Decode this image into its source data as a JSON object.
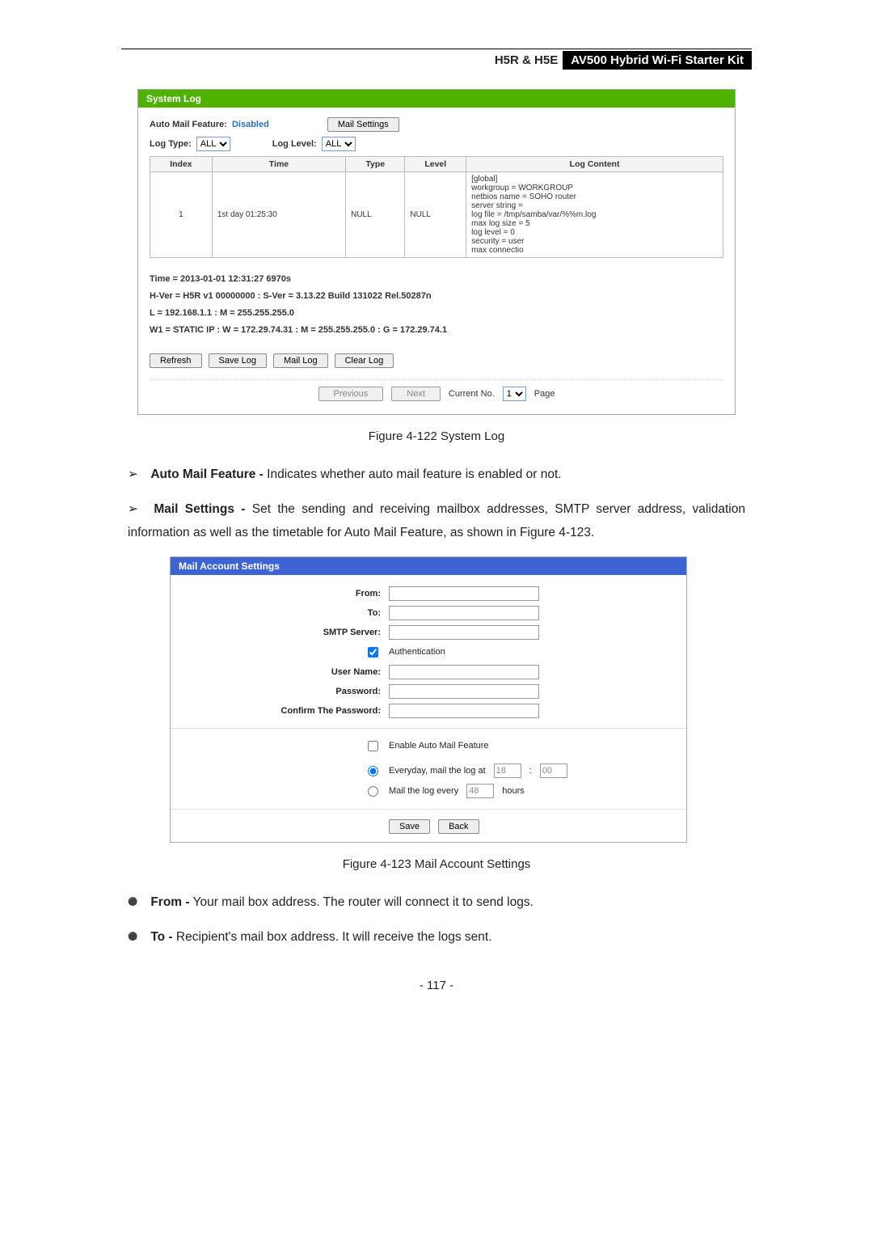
{
  "header": {
    "left": "H5R & H5E",
    "right": "AV500 Hybrid Wi-Fi Starter Kit"
  },
  "systemLogPanel": {
    "title": "System Log",
    "autoMailFeatureLabel": "Auto Mail Feature:",
    "autoMailFeatureValue": "Disabled",
    "mailSettingsBtn": "Mail Settings",
    "logTypeLabel": "Log Type:",
    "logTypeValue": "ALL",
    "logLevelLabel": "Log Level:",
    "logLevelValue": "ALL",
    "tableHeaders": {
      "index": "Index",
      "time": "Time",
      "type": "Type",
      "level": "Level",
      "content": "Log Content"
    },
    "rows": [
      {
        "index": "1",
        "time": "1st day 01:25:30",
        "type": "NULL",
        "level": "NULL",
        "content": "[global]\nworkgroup = WORKGROUP\nnetbios name = SOHO router\nserver string =\nlog file = /tmp/samba/var/%%m.log\nmax log size = 5\nlog level = 0\nsecurity = user\nmax connectio"
      }
    ],
    "sysinfo": {
      "line1": "Time = 2013-01-01 12:31:27 6970s",
      "line2": "H-Ver = H5R v1 00000000 : S-Ver = 3.13.22 Build 131022 Rel.50287n",
      "line3": "L = 192.168.1.1 : M = 255.255.255.0",
      "line4": "W1 = STATIC IP : W = 172.29.74.31 : M = 255.255.255.0 : G = 172.29.74.1"
    },
    "buttons": {
      "refresh": "Refresh",
      "saveLog": "Save Log",
      "mailLog": "Mail Log",
      "clearLog": "Clear Log"
    },
    "pager": {
      "previous": "Previous",
      "next": "Next",
      "currentNoLabel": "Current No.",
      "currentNoValue": "1",
      "pageLabel": "Page"
    }
  },
  "caption1": "Figure 4-122 System Log",
  "textBlocks": {
    "autoMailTitle": "Auto Mail Feature -",
    "autoMailText": " Indicates whether auto mail feature is enabled or not.",
    "mailSettingsTitle": "Mail Settings -",
    "mailSettingsText": " Set the sending and receiving mailbox addresses, SMTP server address, validation information as well as the timetable for Auto Mail Feature, as shown in Figure 4-123."
  },
  "mailPanel": {
    "title": "Mail Account Settings",
    "labels": {
      "from": "From:",
      "to": "To:",
      "smtp": "SMTP Server:",
      "auth": "Authentication",
      "user": "User Name:",
      "pass": "Password:",
      "confirm": "Confirm The Password:",
      "enable": "Enable Auto Mail Feature",
      "everyday": "Everyday, mail the log at",
      "everyday_h": "18",
      "everyday_sep": ":",
      "everyday_m": "00",
      "every": "Mail the log every",
      "every_h": "48",
      "hours": "hours"
    },
    "buttons": {
      "save": "Save",
      "back": "Back"
    }
  },
  "caption2": "Figure 4-123 Mail Account Settings",
  "textBlocks2": {
    "fromTitle": "From -",
    "fromText": " Your mail box address. The router will connect it to send logs.",
    "toTitle": "To -",
    "toText": " Recipient's mail box address. It will receive the logs sent."
  },
  "pageNumber": "- 117 -"
}
